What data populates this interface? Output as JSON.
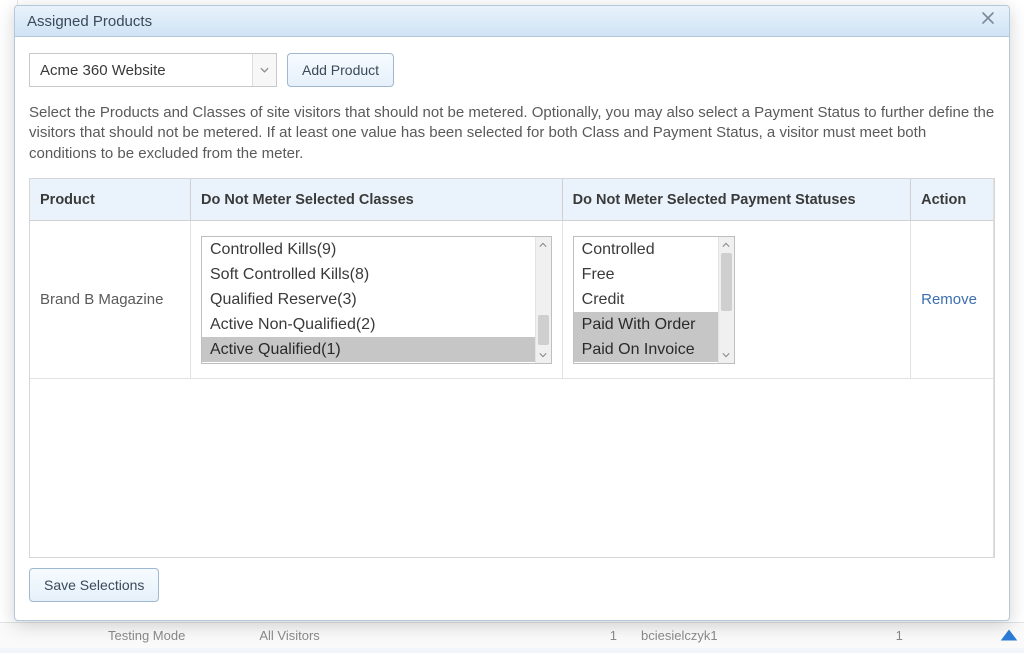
{
  "modal": {
    "title": "Assigned Products",
    "description": "Select the Products and Classes of site visitors that should not be metered. Optionally, you may also select a Payment Status to further define the visitors that should not be metered. If at least one value has been selected for both Class and Payment Status, a visitor must meet both conditions to be excluded from the meter."
  },
  "top": {
    "product_selector_value": "Acme 360 Website",
    "add_product_label": "Add Product"
  },
  "table": {
    "headers": {
      "product": "Product",
      "classes": "Do Not Meter Selected Classes",
      "payment": "Do Not Meter Selected Payment Statuses",
      "action": "Action"
    },
    "rows": [
      {
        "product": "Brand B Magazine",
        "classes": [
          {
            "label": "Controlled Kills(9)",
            "selected": false
          },
          {
            "label": "Soft Controlled Kills(8)",
            "selected": false
          },
          {
            "label": "Qualified Reserve(3)",
            "selected": false
          },
          {
            "label": "Active Non-Qualified(2)",
            "selected": false
          },
          {
            "label": "Active Qualified(1)",
            "selected": true
          }
        ],
        "payment_statuses": [
          {
            "label": "Controlled",
            "selected": false
          },
          {
            "label": "Free",
            "selected": false
          },
          {
            "label": "Credit",
            "selected": false
          },
          {
            "label": "Paid With Order",
            "selected": true
          },
          {
            "label": "Paid On Invoice",
            "selected": true
          }
        ],
        "action_label": "Remove"
      }
    ]
  },
  "buttons": {
    "save_selections": "Save Selections"
  },
  "background_row": {
    "col1": "Testing Mode",
    "col2": "All Visitors",
    "col3": "1",
    "col4": "bciesielczyk1",
    "col5": "1"
  }
}
